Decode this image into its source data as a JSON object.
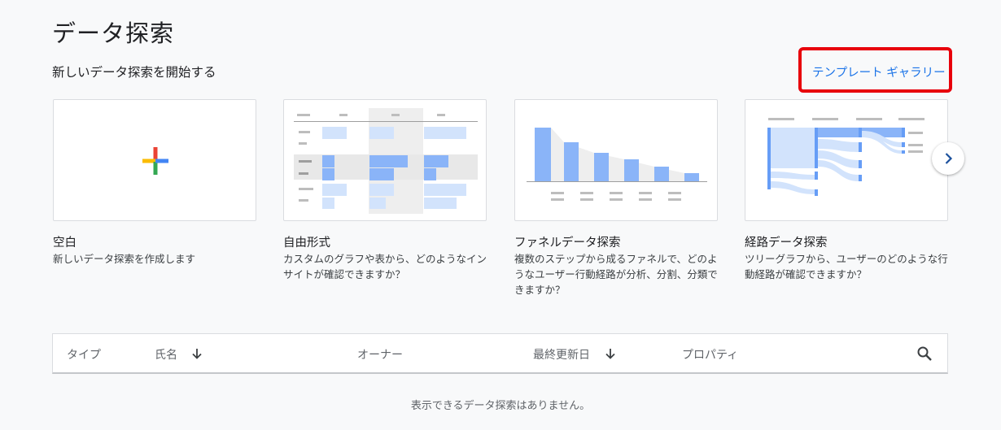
{
  "page": {
    "title": "データ探索",
    "subtitle": "新しいデータ探索を開始する",
    "template_gallery_link": "テンプレート ギャラリー"
  },
  "cards": [
    {
      "title": "空白",
      "description": "新しいデータ探索を作成します"
    },
    {
      "title": "自由形式",
      "description": "カスタムのグラフや表から、どのようなインサイトが確認できますか？"
    },
    {
      "title": "ファネルデータ探索",
      "description": "複数のステップから成るファネルで、どのようなユーザー行動経路が分析、分割、分類できますか？"
    },
    {
      "title": "経路データ探索",
      "description": "ツリーグラフから、ユーザーのどのような行動経路が確認できますか？"
    }
  ],
  "table": {
    "columns": {
      "type": "タイプ",
      "name": "氏名",
      "owner": "オーナー",
      "last_updated": "最終更新日",
      "property": "プロパティ"
    },
    "empty_message": "表示できるデータ探索はありません。"
  },
  "icons": {
    "add": "plus-icon",
    "sort": "arrow-down-icon",
    "search": "search-icon",
    "next": "chevron-right-icon"
  },
  "colors": {
    "link": "#1a73e8",
    "highlight_box": "#e8000b",
    "thumb_blue": "#8ab4f8",
    "thumb_light_blue": "#d2e3fc"
  }
}
